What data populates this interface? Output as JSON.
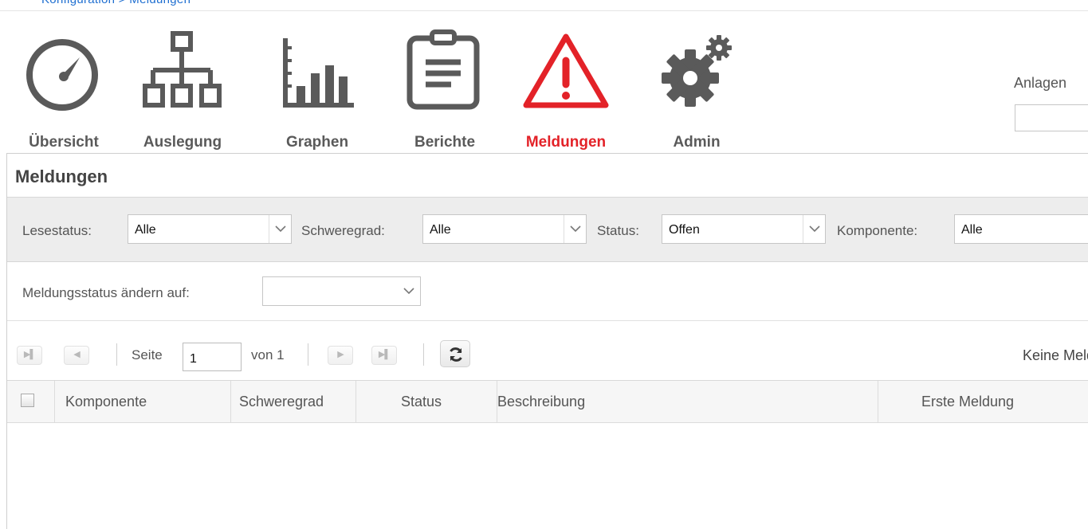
{
  "breadcrumb": "Konfiguration > Meldungen",
  "nav": {
    "items": [
      {
        "label": "Übersicht",
        "icon": "gauge-icon",
        "active": false
      },
      {
        "label": "Auslegung",
        "icon": "sitemap-icon",
        "active": false
      },
      {
        "label": "Graphen",
        "icon": "bar-chart-icon",
        "active": false
      },
      {
        "label": "Berichte",
        "icon": "clipboard-icon",
        "active": false
      },
      {
        "label": "Meldungen",
        "icon": "warning-icon",
        "active": true
      },
      {
        "label": "Admin",
        "icon": "gears-icon",
        "active": false
      }
    ],
    "anlage_label": "Anlagen",
    "anlage_value": ""
  },
  "colors": {
    "active": "#e32228",
    "icon": "#5a5a5a",
    "link": "#1f6fd1"
  },
  "panel": {
    "title": "Meldungen",
    "filters": {
      "lesestatus": {
        "label": "Lesestatus:",
        "value": "Alle"
      },
      "schweregrad": {
        "label": "Schweregrad:",
        "value": "Alle"
      },
      "status": {
        "label": "Status:",
        "value": "Offen"
      },
      "komponente": {
        "label": "Komponente:",
        "value": "Alle"
      }
    },
    "change_status": {
      "label": "Meldungsstatus ändern auf:",
      "value": ""
    },
    "pager": {
      "page_label": "Seite",
      "page_value": "1",
      "of_label": "von 1",
      "empty_text": "Keine Meldungen"
    },
    "columns": [
      "Komponente",
      "Schweregrad",
      "Status",
      "Beschreibung",
      "Erste Meldung"
    ],
    "rows": []
  }
}
